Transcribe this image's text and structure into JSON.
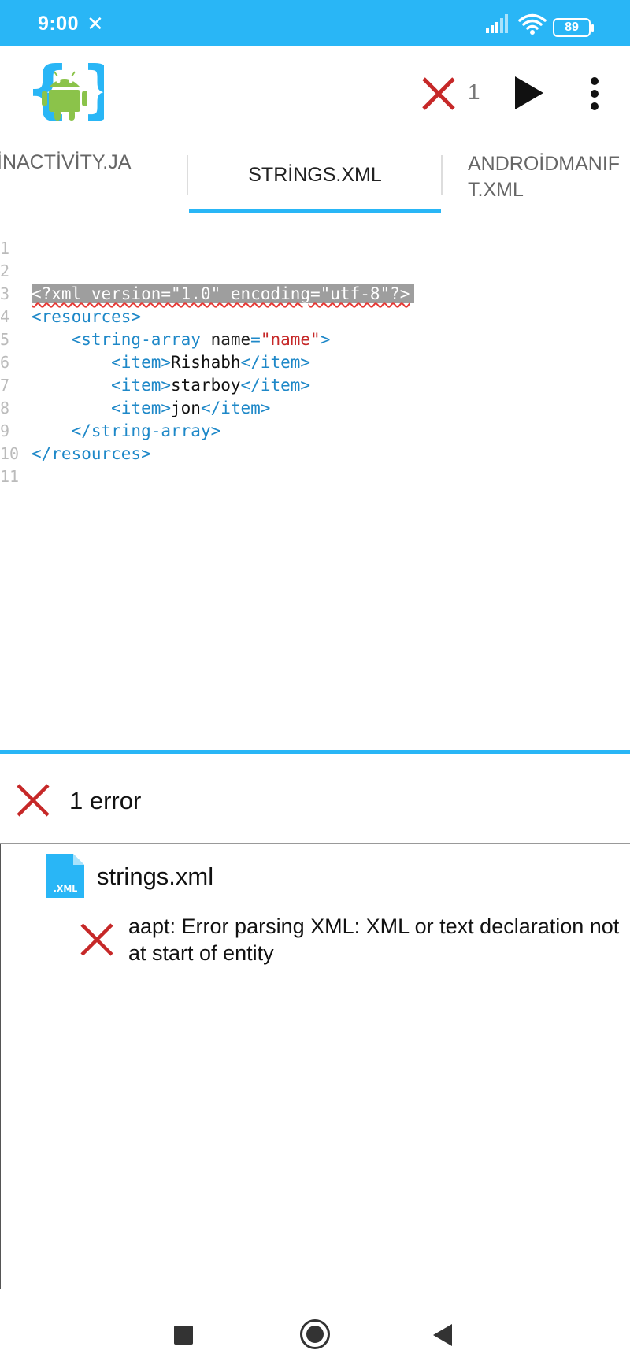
{
  "status_bar": {
    "time": "9:00",
    "notification_icon": "close-icon",
    "battery": "89"
  },
  "toolbar": {
    "error_count": "1",
    "logo_icon": "android-app-logo",
    "run_icon": "play-icon",
    "more_icon": "more-vert-icon"
  },
  "tabs": [
    {
      "label": "İNACTİVİTY.JA"
    },
    {
      "label": "STRİNGS.XML",
      "active": true
    },
    {
      "label_lines": [
        "ANDROİDMANIF",
        "T.XML"
      ]
    }
  ],
  "editor": {
    "lines": [
      {
        "num": "1"
      },
      {
        "num": "2",
        "text": "<?xml version=\"1.0\" encoding=\"utf-8\"?>"
      },
      {
        "num": "3",
        "open": "<resources>"
      },
      {
        "num": "4",
        "indent": "    ",
        "open": "<string-array ",
        "attr": "name",
        "eq": "=",
        "val": "\"name\"",
        "close": ">"
      },
      {
        "num": "5",
        "indent": "        ",
        "open": "<item>",
        "text": "Rishabh",
        "close": "</item>"
      },
      {
        "num": "6",
        "indent": "        ",
        "open": "<item>",
        "text": "starboy",
        "close": "</item>"
      },
      {
        "num": "7",
        "indent": "        ",
        "open": "<item>",
        "text": "jon",
        "close": "</item>"
      },
      {
        "num": "8",
        "indent": "    ",
        "close": "</string-array>"
      },
      {
        "num": "9",
        "close": "</resources>"
      },
      {
        "num": "10"
      },
      {
        "num": "11"
      }
    ]
  },
  "problems_panel": {
    "summary": "1 error",
    "file": {
      "name": "strings.xml",
      "icon_label": ".XML"
    },
    "message": "aapt: Error parsing XML: XML or text declaration not at start of entity"
  },
  "colors": {
    "accent": "#29b6f6",
    "error": "#c62828",
    "tag": "#1e88c8",
    "string": "#c62828"
  }
}
